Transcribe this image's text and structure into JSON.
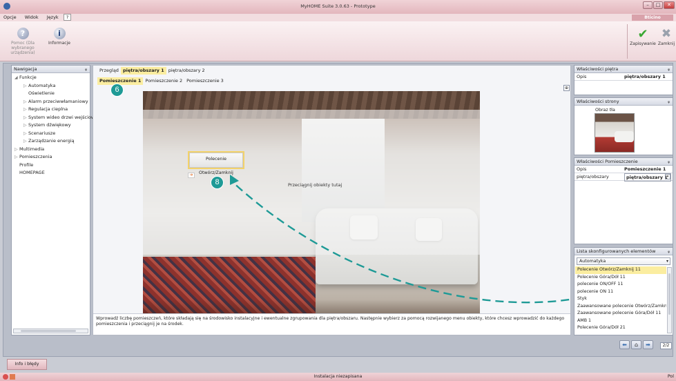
{
  "window": {
    "title": "MyHOME Suite 3.0.63 - Prototype",
    "controls": [
      "–",
      "□",
      "✕"
    ],
    "logo": "Bticino"
  },
  "menu": [
    "Opcje",
    "Widok",
    "Język",
    "?"
  ],
  "ribbon": {
    "help_label": "Pomoc (Dla wybranego urządzenia)",
    "info_label": "Informacje",
    "save_label": "Zapisywanie",
    "close_label": "Zamknij"
  },
  "nav": {
    "title": "Nawigacja",
    "pin": "ᵩ",
    "items": [
      "Funkcje",
      "Automatyka",
      "Oświetlenie",
      "Alarm przeciwwłamaniowy",
      "Regulacja cieplna",
      "System wideo drzwi wejściowych",
      "System dźwiękowy",
      "Scenariusze",
      "Zarządzanie energią",
      "Multimedia",
      "Pomieszczenia",
      "Profile",
      "HOMEPAGE"
    ]
  },
  "tabs": {
    "overview": "Przegląd",
    "floor1": "piętra/obszary 1",
    "floor2": "piętra/obszary 2"
  },
  "rooms": {
    "room1": "Pomieszczenie 1",
    "room2": "Pomieszczenie 2",
    "room3": "Pomieszczenie 3"
  },
  "canvas": {
    "drop_hint": "Przeciągnij obiekty tutaj",
    "widget_label": "Polecenie Otwórz/Zamknij"
  },
  "callouts": {
    "c6": "6",
    "c7": "7",
    "c8": "8"
  },
  "info_text": "Wprowadź liczbę pomieszczeń, które składają się na środowisko instalacyjne i ewentualne zgrupowania dla piętra/obszaru. Następnie wybierz za pomocą rozwijanego menu obiekty, które chcesz wprowadzić do każdego pomieszczenia i przeciągnij je na środek.",
  "floor_props": {
    "title": "Właściwości piętra",
    "key": "Opis",
    "value": "piętra/obszary 1"
  },
  "page_props": {
    "title": "Właściwości strony",
    "bg_label": "Obraz tła"
  },
  "room_props": {
    "title": "Właściwości Pomieszczenie",
    "rows": [
      {
        "k": "Opis",
        "v": "Pomieszczenie 1"
      },
      {
        "k": "piętra/obszary",
        "v": "piętra/obszary 1"
      }
    ]
  },
  "configured": {
    "title": "Lista skonfigurowanych elementów",
    "dropdown": "Automatyka",
    "items": [
      "Polecenie Otwórz/Zamknij 11",
      "Polecenie Góra/Dół 11",
      "polecenie ON/OFF 11",
      "polecenie ON 11",
      "Styk",
      "Zaawansowane polecenie Otwórz/Zamknij 11",
      "Zaawansowane polecenie Góra/Dół 11",
      "AMB 1",
      "Polecenie Góra/Dół 21"
    ]
  },
  "pager": "2/2",
  "bottom_tab": "Info i błędy",
  "status": "Instalacja niezapisana",
  "status_right": "Pol",
  "colors": {
    "accent": "#1e9a96",
    "selection": "#fbeda0"
  }
}
